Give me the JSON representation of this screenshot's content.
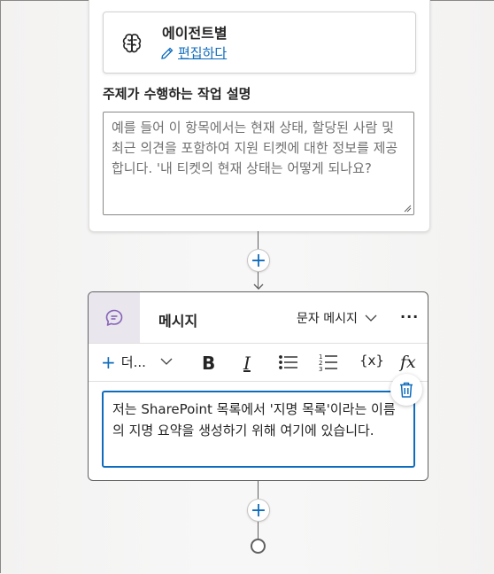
{
  "agent_section": {
    "agent_name": "에이전트별",
    "edit_link": "편집하다",
    "description_label": "주제가 수행하는 작업 설명",
    "description_placeholder": "예를 들어 이 항목에서는 현재 상태, 할당된 사람 및 최근 의견을 포함하여 지원 티켓에 대한 정보를 제공합니다. '내 티켓의 현재 상태는 어떻게 되나요?"
  },
  "connectors": {
    "add_symbol": "+"
  },
  "message_node": {
    "title": "메시지",
    "type_selector": "문자 메시지",
    "more_symbol": "···",
    "toolbar": {
      "add_more_label": "더...",
      "bold": "B",
      "italic": "I",
      "variable": "{x}",
      "formula": "fx"
    },
    "message_text": "저는 SharePoint 목록에서 '지명 목록'이라는 이름의 지명 요약을 생성하기 위해 여기에 있습니다."
  },
  "colors": {
    "accent": "#0f6cbd",
    "message_icon_bg": "#eae6ee",
    "message_icon": "#8764b8"
  }
}
